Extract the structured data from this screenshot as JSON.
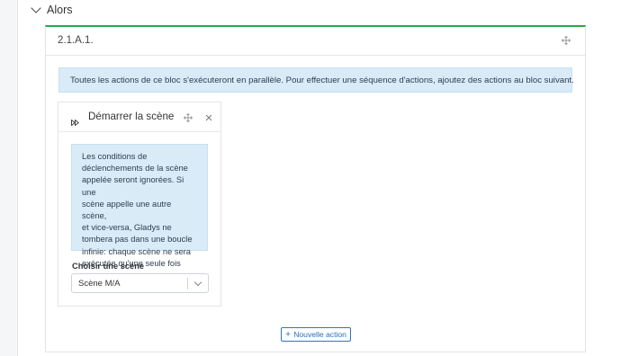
{
  "section": {
    "title": "Alors",
    "icon": "chevron-down-icon"
  },
  "block": {
    "title": "2.1.A.1.",
    "move_icon": "move-icon",
    "accent_color": "#28a745",
    "info": "Toutes les actions de ce bloc s'exécuteront en parallèle. Pour effectuer une séquence d'actions, ajoutez des actions au bloc suivant."
  },
  "action_card": {
    "icon": "fast-forward-icon",
    "title": "Démarrer la scène",
    "note_lines": [
      "Les conditions de",
      "déclenchements de la scène",
      "appelée seront ignorées. Si une",
      "scène appelle une autre scène,",
      "et vice-versa, Gladys ne",
      "tombera pas dans une boucle",
      "infinie: chaque scène ne sera",
      "exécutée qu'une seule fois"
    ],
    "select_label": "Choisir une scène",
    "select_value": "Scène M/A"
  },
  "add_button": {
    "label": "Nouvelle action",
    "icon": "plus-icon"
  },
  "colors": {
    "info_bg": "#d9ebf7",
    "button": "#3273c2"
  }
}
